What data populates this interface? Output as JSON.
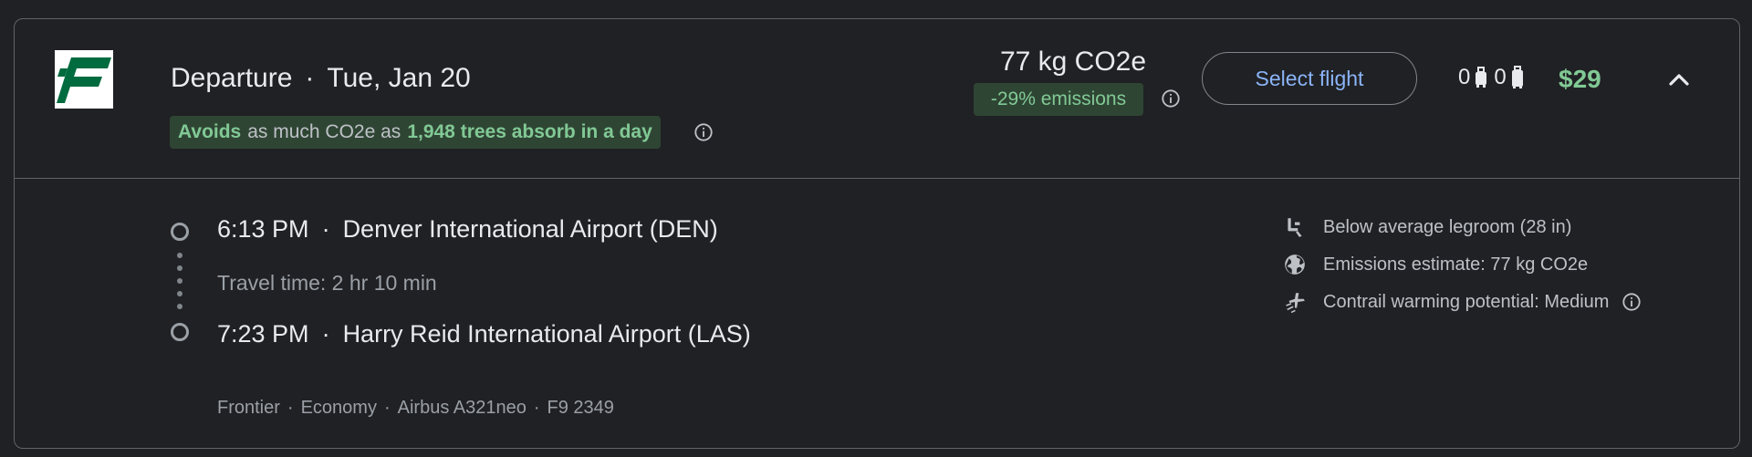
{
  "header": {
    "title_prefix": "Departure",
    "separator": "·",
    "date": "Tue, Jan 20",
    "eco_badge": {
      "strong_a": "Avoids",
      "middle": "as much CO2e as",
      "strong_b": "1,948 trees absorb in a day"
    },
    "emissions": {
      "amount": "77 kg CO2e",
      "change": "-29% emissions"
    },
    "select_button": "Select flight",
    "carry_on_count": "0",
    "checked_count": "0",
    "price": "$29"
  },
  "itinerary": {
    "departure": {
      "time": "6:13 PM",
      "separator": "·",
      "airport": "Denver International Airport (DEN)"
    },
    "travel_time": "Travel time: 2 hr 10 min",
    "arrival": {
      "time": "7:23 PM",
      "separator": "·",
      "airport": "Harry Reid International Airport (LAS)"
    },
    "details": {
      "airline": "Frontier",
      "cabin": "Economy",
      "aircraft": "Airbus A321neo",
      "flight_number": "F9 2349",
      "separator": "·"
    }
  },
  "amenities": [
    {
      "icon": "seat-legroom-icon",
      "label": "Below average legroom (28 in)"
    },
    {
      "icon": "globe-icon",
      "label": "Emissions estimate: 77 kg CO2e"
    },
    {
      "icon": "contrail-icon",
      "label": "Contrail warming potential: Medium"
    }
  ],
  "colors": {
    "background": "#202124",
    "accent_green": "#81c995",
    "accent_blue": "#8ab4f8",
    "brand_green": "#006b3f"
  }
}
